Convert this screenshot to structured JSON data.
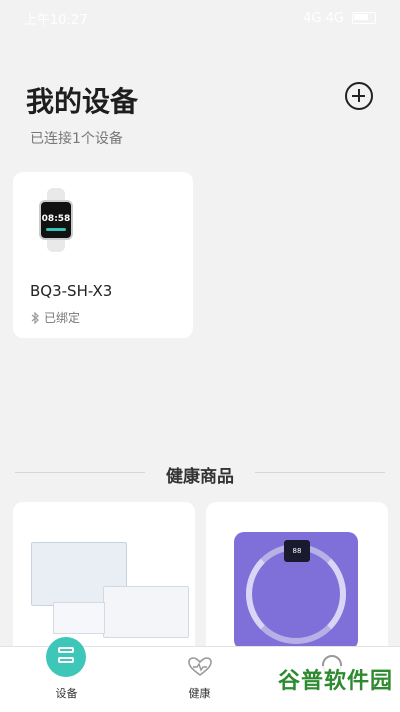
{
  "status": {
    "time": "上午10:27",
    "signal": "4G 4G",
    "battery_icon": "battery-icon"
  },
  "header": {
    "title": "我的设备",
    "subtitle": "已连接1个设备",
    "add_icon": "plus-circle-icon"
  },
  "device": {
    "name": "BQ3-SH-X3",
    "status": "已绑定",
    "watch_time": "08:58"
  },
  "products": {
    "section_title": "健康商品"
  },
  "nav": {
    "devices": "设备",
    "health": "健康",
    "mine": ""
  },
  "watermark": "谷普软件园",
  "colors": {
    "accent": "#3ec7b8",
    "scale": "#7f6fd9"
  }
}
